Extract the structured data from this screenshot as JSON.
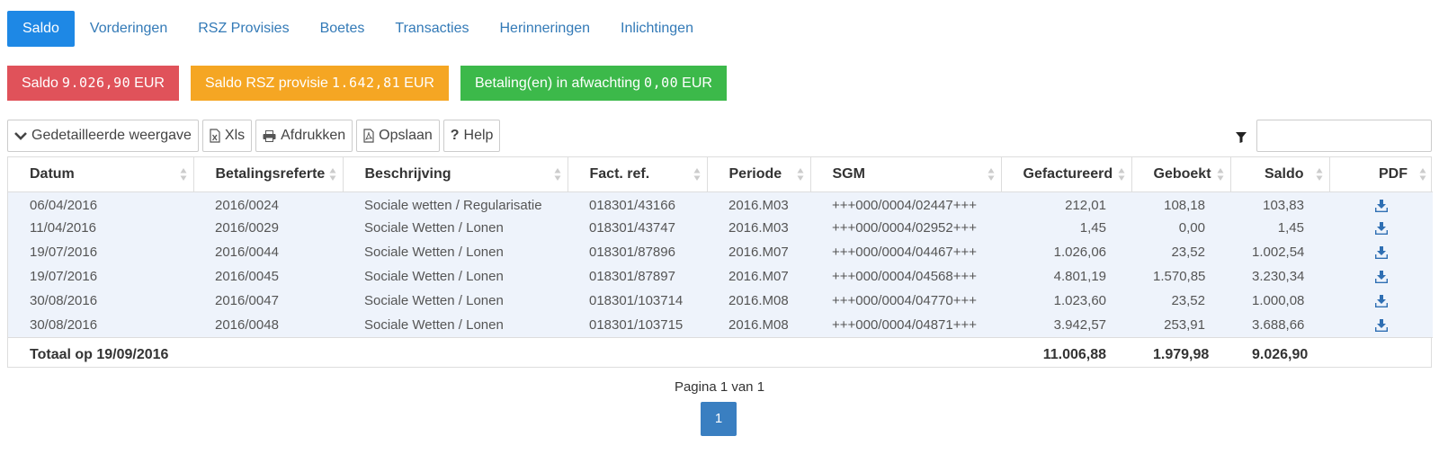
{
  "tabs": [
    {
      "label": "Saldo",
      "active": true
    },
    {
      "label": "Vorderingen",
      "active": false
    },
    {
      "label": "RSZ Provisies",
      "active": false
    },
    {
      "label": "Boetes",
      "active": false
    },
    {
      "label": "Transacties",
      "active": false
    },
    {
      "label": "Herinneringen",
      "active": false
    },
    {
      "label": "Inlichtingen",
      "active": false
    }
  ],
  "badges": [
    {
      "label": "Saldo",
      "amount": "9.026,90",
      "currency": "EUR",
      "color": "#e0525a"
    },
    {
      "label": "Saldo RSZ provisie",
      "amount": "1.642,81",
      "currency": "EUR",
      "color": "#f5a623"
    },
    {
      "label": "Betaling(en) in afwachting",
      "amount": "0,00",
      "currency": "EUR",
      "color": "#3cb94a"
    }
  ],
  "toolbar": {
    "detailed_view": "Gedetailleerde weergave",
    "xls": "Xls",
    "print": "Afdrukken",
    "save": "Opslaan",
    "help": "Help",
    "filter_value": ""
  },
  "table": {
    "columns": [
      "Datum",
      "Betalingsreferte",
      "Beschrijving",
      "Fact. ref.",
      "Periode",
      "SGM",
      "Gefactureerd",
      "Geboekt",
      "Saldo",
      "PDF"
    ],
    "rows": [
      [
        "06/04/2016",
        "2016/0024",
        "Sociale wetten / Regularisatie",
        "018301/43166",
        "2016.M03",
        "+++000/0004/02447+++",
        "212,01",
        "108,18",
        "103,83"
      ],
      [
        "11/04/2016",
        "2016/0029",
        "Sociale Wetten / Lonen",
        "018301/43747",
        "2016.M03",
        "+++000/0004/02952+++",
        "1,45",
        "0,00",
        "1,45"
      ],
      [
        "19/07/2016",
        "2016/0044",
        "Sociale Wetten / Lonen",
        "018301/87896",
        "2016.M07",
        "+++000/0004/04467+++",
        "1.026,06",
        "23,52",
        "1.002,54"
      ],
      [
        "19/07/2016",
        "2016/0045",
        "Sociale Wetten / Lonen",
        "018301/87897",
        "2016.M07",
        "+++000/0004/04568+++",
        "4.801,19",
        "1.570,85",
        "3.230,34"
      ],
      [
        "30/08/2016",
        "2016/0047",
        "Sociale Wetten / Lonen",
        "018301/103714",
        "2016.M08",
        "+++000/0004/04770+++",
        "1.023,60",
        "23,52",
        "1.000,08"
      ],
      [
        "30/08/2016",
        "2016/0048",
        "Sociale Wetten / Lonen",
        "018301/103715",
        "2016.M08",
        "+++000/0004/04871+++",
        "3.942,57",
        "253,91",
        "3.688,66"
      ]
    ],
    "pdf_icon": "download-icon",
    "footer": {
      "label": "Totaal op 19/09/2016",
      "gefactureerd": "11.006,88",
      "geboekt": "1.979,98",
      "saldo": "9.026,90"
    }
  },
  "pagination": {
    "label": "Pagina 1 van 1",
    "current": "1"
  }
}
